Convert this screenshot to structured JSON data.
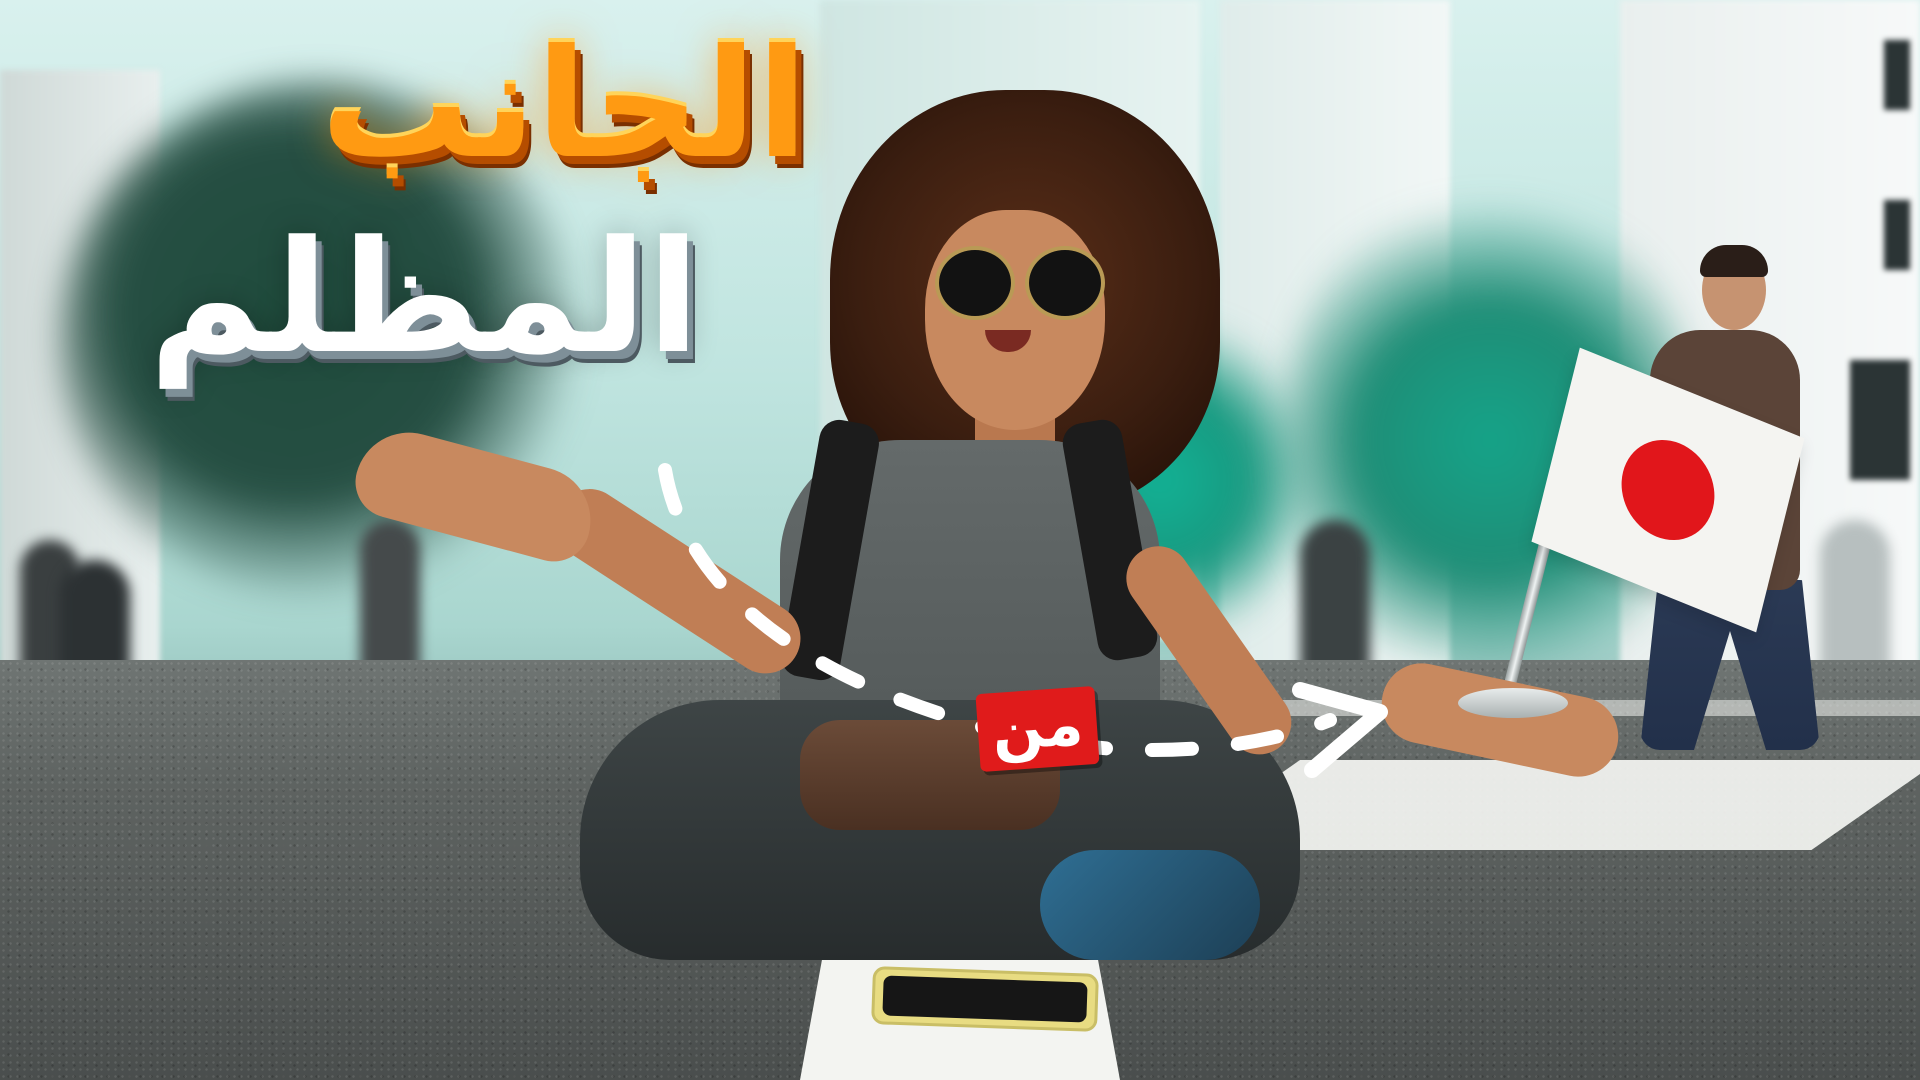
{
  "thumbnail": {
    "headline_line1": "الجانب",
    "headline_line2": "المظلم",
    "tag_word": "من"
  },
  "colors": {
    "headline_line1": "#ff9a12",
    "headline_line2": "#ffffff",
    "tag_background": "#e01b1b",
    "flag_sun": "#e1161b"
  },
  "icons": {
    "dashed_arrow": "dashed-arrow-icon",
    "flag": "japan-flag-icon"
  }
}
